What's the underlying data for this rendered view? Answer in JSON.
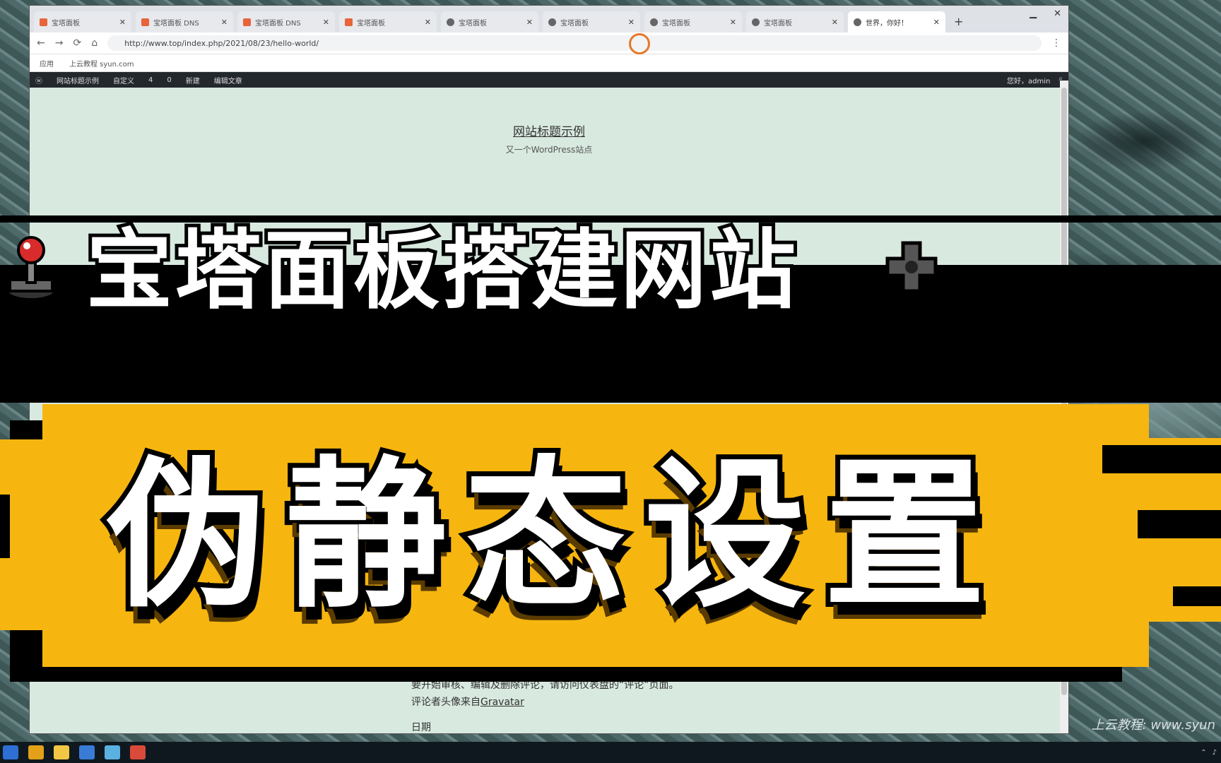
{
  "browser": {
    "tabs": [
      {
        "title": "宝塔面板",
        "active": false
      },
      {
        "title": "宝塔面板 DNS",
        "active": false
      },
      {
        "title": "宝塔面板 DNS",
        "active": false
      },
      {
        "title": "宝塔面板",
        "active": false
      },
      {
        "title": "宝塔面板",
        "active": false
      },
      {
        "title": "宝塔面板",
        "active": false
      },
      {
        "title": "宝塔面板",
        "active": false
      },
      {
        "title": "宝塔面板",
        "active": false
      },
      {
        "title": "世界，你好！",
        "active": true
      }
    ],
    "new_tab_label": "+",
    "url": "http://www.top/index.php/2021/08/23/hello-world/",
    "bookmarks": [
      "应用",
      "上云教程 syun.com"
    ],
    "wp_admin_bar": {
      "items": [
        "网站标题示例",
        "自定义",
        "4",
        "0",
        "新建",
        "编辑文章"
      ],
      "greeting": "您好，admin"
    }
  },
  "site": {
    "title": "网站标题示例",
    "description": "又一个WordPress站点"
  },
  "post": {
    "line1": "要开始审核、编辑及删除评论，请访问仪表盘的“评论”页面。",
    "line2_prefix": "评论者头像来自",
    "line2_link": "Gravatar",
    "line3": "日期"
  },
  "overlay": {
    "subtitle": "宝塔面板搭建网站",
    "title": "伪静态设置",
    "watermark": "上云教程: www.syun"
  },
  "colors": {
    "banner": "#f6b60f",
    "page_bg": "#d8e9e0",
    "admin_bar": "#23282d"
  }
}
